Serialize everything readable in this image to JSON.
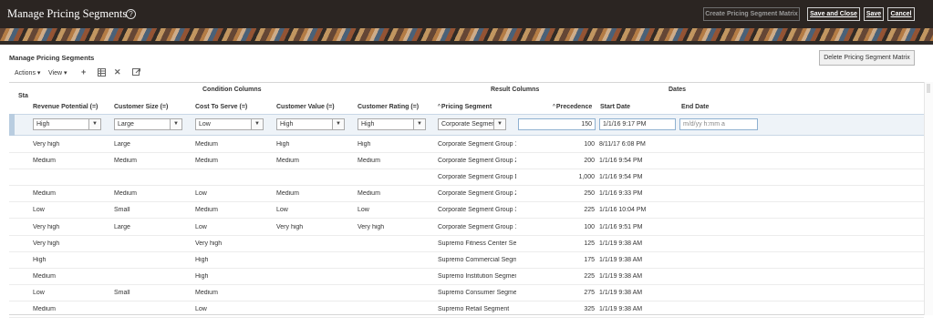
{
  "header": {
    "title": "Manage Pricing Segments",
    "help_icon": "?",
    "buttons": {
      "create_matrix": "Create Pricing Segment Matrix",
      "save_and_close": "Save and Close",
      "save": "Save",
      "cancel": "Cancel"
    }
  },
  "section": {
    "title": "Manage Pricing Segments",
    "delete_button": "Delete Pricing Segment Matrix"
  },
  "toolbar": {
    "actions": "Actions ▾",
    "view": "View ▾",
    "add_icon": "plus-icon",
    "export_icon": "spreadsheet-icon",
    "delete_icon": "x-icon",
    "detach_icon": "detach-icon"
  },
  "table": {
    "status_label": "Sta",
    "groups": {
      "condition": "Condition Columns",
      "result": "Result Columns",
      "dates": "Dates"
    },
    "columns": {
      "revenue": "Revenue Potential (=)",
      "size": "Customer Size (=)",
      "cost": "Cost To Serve (=)",
      "value": "Customer Value (=)",
      "rating": "Customer Rating (=)",
      "segment": "Pricing Segment",
      "precedence": "Precedence",
      "start": "Start Date",
      "end": "End Date"
    },
    "filter": {
      "revenue": "High",
      "size": "Large",
      "cost": "Low",
      "value": "High",
      "rating": "High",
      "segment": "Corporate Segmen",
      "precedence": "150",
      "start": "1/1/16 9:17 PM",
      "end_placeholder": "m/d/yy h:mm a"
    },
    "rows": [
      {
        "revenue": "Very high",
        "size": "Large",
        "cost": "Medium",
        "value": "High",
        "rating": "High",
        "segment": "Corporate Segment Group 1",
        "precedence": "100",
        "start": "8/11/17 6:08 PM"
      },
      {
        "revenue": "Medium",
        "size": "Medium",
        "cost": "Medium",
        "value": "Medium",
        "rating": "Medium",
        "segment": "Corporate Segment Group 2",
        "precedence": "200",
        "start": "1/1/16 9:54 PM"
      },
      {
        "revenue": "",
        "size": "",
        "cost": "",
        "value": "",
        "rating": "",
        "segment": "Corporate Segment Group De",
        "precedence": "1,000",
        "start": "1/1/16 9:54 PM"
      },
      {
        "revenue": "Medium",
        "size": "Medium",
        "cost": "Low",
        "value": "Medium",
        "rating": "Medium",
        "segment": "Corporate Segment Group 2",
        "precedence": "250",
        "start": "1/1/16 9:33 PM"
      },
      {
        "revenue": "Low",
        "size": "Small",
        "cost": "Medium",
        "value": "Low",
        "rating": "Low",
        "segment": "Corporate Segment Group 3",
        "precedence": "225",
        "start": "1/1/16 10:04 PM"
      },
      {
        "revenue": "Very high",
        "size": "Large",
        "cost": "Low",
        "value": "Very high",
        "rating": "Very high",
        "segment": "Corporate Segment Group 1",
        "precedence": "100",
        "start": "1/1/16 9:51 PM"
      },
      {
        "revenue": "Very high",
        "size": "",
        "cost": "Very high",
        "value": "",
        "rating": "",
        "segment": "Supremo Fitness Center Seg",
        "precedence": "125",
        "start": "1/1/19 9:38 AM"
      },
      {
        "revenue": "High",
        "size": "",
        "cost": "High",
        "value": "",
        "rating": "",
        "segment": "Supremo Commercial Segme",
        "precedence": "175",
        "start": "1/1/19 9:38 AM"
      },
      {
        "revenue": "Medium",
        "size": "",
        "cost": "High",
        "value": "",
        "rating": "",
        "segment": "Supremo Institution Segment",
        "precedence": "225",
        "start": "1/1/19 9:38 AM"
      },
      {
        "revenue": "Low",
        "size": "Small",
        "cost": "Medium",
        "value": "",
        "rating": "",
        "segment": "Supremo Consumer Segmen",
        "precedence": "275",
        "start": "1/1/19 9:38 AM"
      },
      {
        "revenue": "Medium",
        "size": "",
        "cost": "Low",
        "value": "",
        "rating": "",
        "segment": "Supremo Retail Segment",
        "precedence": "325",
        "start": "1/1/19 9:38 AM"
      }
    ]
  }
}
